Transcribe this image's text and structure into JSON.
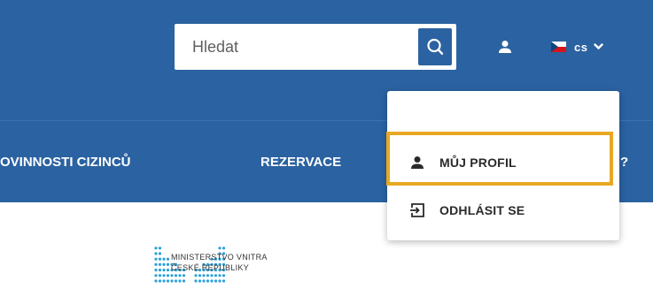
{
  "search": {
    "placeholder": "Hledat"
  },
  "language": {
    "code": "cs",
    "flag": "czech-flag"
  },
  "nav": {
    "items": [
      {
        "label": "OVINNOSTI CIZINCŮ"
      },
      {
        "label": "REZERVACE"
      },
      {
        "label": "?"
      }
    ]
  },
  "user_menu": {
    "items": [
      {
        "label": "MŮJ PROFIL",
        "icon": "person-icon",
        "highlighted": true
      },
      {
        "label": "ODHLÁSIT SE",
        "icon": "logout-icon"
      }
    ]
  },
  "logo": {
    "line1": "MINISTERSTVO VNITRA",
    "line2": "ČESKÉ REPUBLIKY"
  },
  "colors": {
    "header": "#2b62a1",
    "highlight": "#e8a823",
    "logo_dots": "#2aa0d8"
  }
}
